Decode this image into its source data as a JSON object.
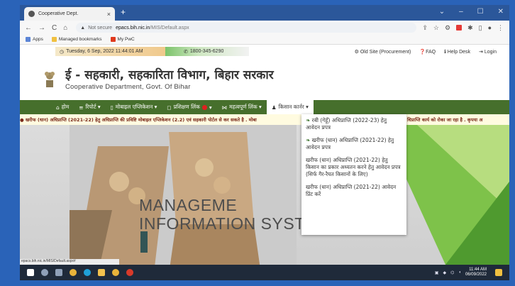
{
  "browser": {
    "tab_title": "Cooperative Dept.",
    "tab_close": "×",
    "new_tab": "+",
    "window_controls": [
      "⌄",
      "–",
      "☐",
      "✕"
    ],
    "nav": [
      "←",
      "→",
      "C",
      "⌂"
    ],
    "security_label": "Not secure",
    "url_domain": "epacs.bih.nic.in",
    "url_path": "/MIS/Default.aspx",
    "bookmarks": [
      {
        "label": "Apps",
        "color": "#5c85d6"
      },
      {
        "label": "Managed bookmarks",
        "color": "#f0c040"
      },
      {
        "label": "My PwC",
        "color": "#e03a1e"
      }
    ]
  },
  "infobar": {
    "date": "Tuesday, 6 Sep, 2022 11:44:01 AM",
    "phone": "1800-345-6290",
    "links": [
      "Old Site (Procurement)",
      "FAQ",
      "Help Desk",
      "Login"
    ]
  },
  "header": {
    "title": "ई - सहकारी, सहकारिता विभाग, बिहार सरकार",
    "subtitle": "Cooperative Department, Govt. Of Bihar"
  },
  "menu": [
    {
      "label": "होम",
      "icon": "home-icon"
    },
    {
      "label": "रिपोर्ट ▾",
      "icon": "list-icon"
    },
    {
      "label": "मोबाइल एप्लिकेशन ▾",
      "icon": "mobile-icon"
    },
    {
      "label": "प्रशिक्षण लिंक",
      "icon": "chat-icon"
    },
    {
      "label": "महत्वपूर्ण लिंक ▾",
      "icon": "share-icon"
    },
    {
      "label": "किसान कार्नर ▾",
      "icon": "user-icon"
    }
  ],
  "ticker": "● खरीफ (धान) अधिप्राप्ति (2021-22) हेतु अधिप्राप्ति की प्रविष्टि मोबाइल एप्लिकेशन (2.2) एवं सहकारी पोर्टल से कर सकते है . मोबा",
  "ticker_tail": "धिप्राप्ति कार्य को रोका जा रहा है . कृपया अ",
  "dropdown": [
    "रबी (गेहूँ) अधिप्राप्ति (2022-23) हेतु आवेदन प्रपत्र",
    "खरीफ (धान) अधिप्राप्ति (2021-22) हेतु आवेदन प्रपत्र",
    "खरीफ (धान) अधिप्राप्ति (2021-22) हेतु किसान का प्रकार अध्यतन करने हेतु आवेदन प्रपत्र (सिर्फ गैर-रैयत किसानों के लिए)",
    "खरीफ (धान) अधिप्राप्ति (2021-22) आवेदन प्रिंट करें"
  ],
  "banner": {
    "line1": "MANAGEME",
    "line2": "INFORMATION SYSTEM"
  },
  "status_url": "epacs.bih.nic.in/MIS/Default.aspx#",
  "taskbar": {
    "time": "11:44 AM",
    "date": "06/09/2022"
  }
}
